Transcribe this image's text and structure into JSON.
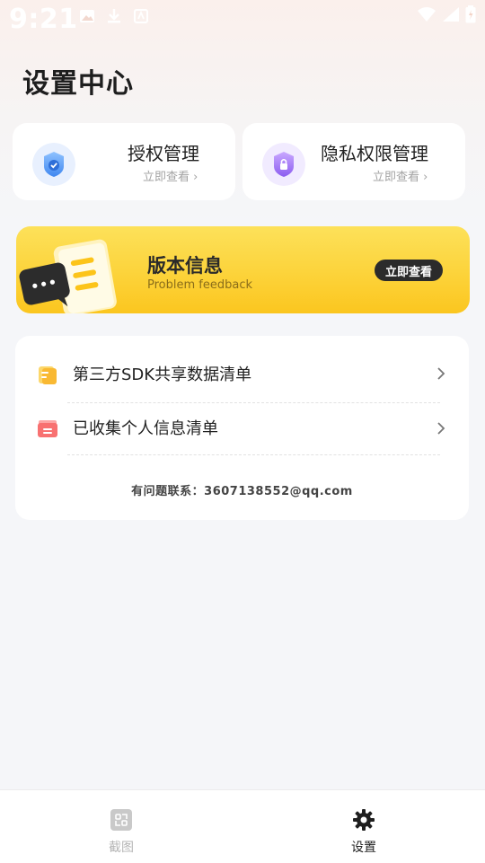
{
  "status_bar": {
    "time": "9:21"
  },
  "page": {
    "title": "设置中心"
  },
  "cards": [
    {
      "title": "授权管理",
      "subtitle": "立即查看 ›",
      "icon": "shield-check-icon"
    },
    {
      "title": "隐私权限管理",
      "subtitle": "立即查看 ›",
      "icon": "shield-lock-icon"
    }
  ],
  "banner": {
    "title": "版本信息",
    "subtitle": "Problem feedback",
    "button": "立即查看"
  },
  "list": {
    "items": [
      {
        "label": "第三方SDK共享数据清单",
        "icon": "document-icon"
      },
      {
        "label": "已收集个人信息清单",
        "icon": "folder-icon"
      }
    ],
    "contact": "有问题联系：3607138552@qq.com"
  },
  "bottom_nav": [
    {
      "label": "截图",
      "icon": "screenshot-icon",
      "active": false
    },
    {
      "label": "设置",
      "icon": "gear-icon",
      "active": true
    }
  ],
  "colors": {
    "accent_yellow": "#fcd33a",
    "text_dark": "#1e1e1e",
    "muted": "#a3a3a3"
  }
}
